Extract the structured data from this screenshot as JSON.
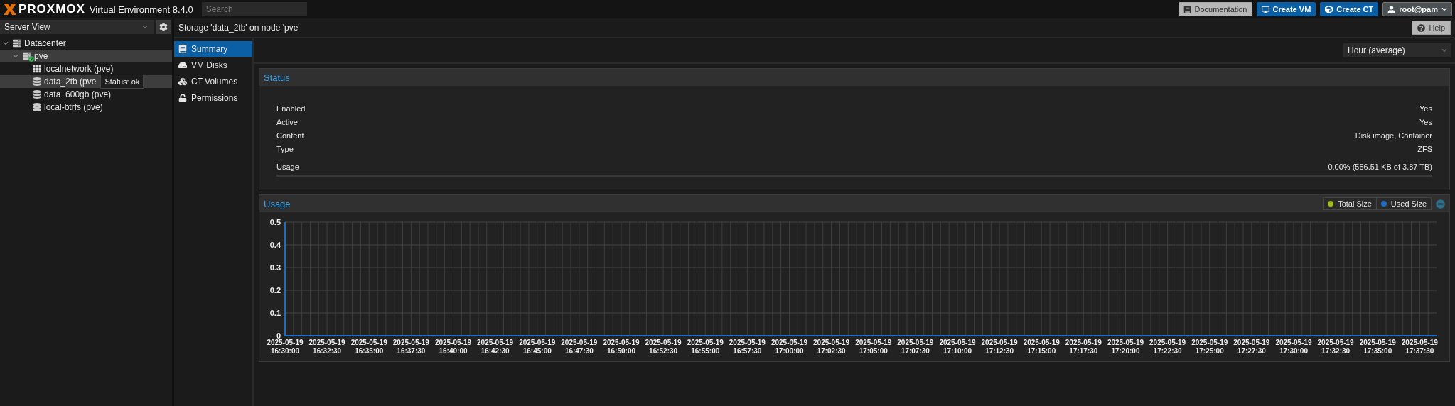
{
  "header": {
    "logo": "PROXMOX",
    "product": "Virtual Environment 8.4.0",
    "search": {
      "placeholder": "Search"
    },
    "buttons": [
      {
        "label": "Documentation",
        "kind": "doc"
      },
      {
        "label": "Create VM",
        "kind": "vm"
      },
      {
        "label": "Create CT",
        "kind": "ct"
      },
      {
        "label": "root@pam",
        "kind": "user"
      }
    ]
  },
  "sidebar": {
    "view": "Server View",
    "tree": [
      {
        "label": "Datacenter",
        "kind": "datacenter",
        "expanded": true,
        "selected": false,
        "children": [
          {
            "label": "pve",
            "kind": "node",
            "expanded": true,
            "selected": true,
            "children": [
              {
                "label": "localnetwork (pve)",
                "kind": "network",
                "selected": false
              },
              {
                "label": "data_2tb (pve",
                "kind": "storage",
                "selected": true,
                "tooltip": "Status: ok"
              },
              {
                "label": "data_600gb (pve)",
                "kind": "storage",
                "selected": false
              },
              {
                "label": "local-btrfs (pve)",
                "kind": "storage",
                "selected": false
              }
            ]
          }
        ]
      }
    ]
  },
  "page": {
    "title": "Storage 'data_2tb' on node 'pve'",
    "help": "Help"
  },
  "nav": [
    {
      "label": "Summary",
      "kind": "summary",
      "selected": true
    },
    {
      "label": "VM Disks",
      "kind": "disks",
      "selected": false
    },
    {
      "label": "CT Volumes",
      "kind": "volumes",
      "selected": false
    },
    {
      "label": "Permissions",
      "kind": "permissions",
      "selected": false
    }
  ],
  "timeframe": "Hour (average)",
  "status": {
    "title": "Status",
    "rows": [
      {
        "label": "Enabled",
        "value": "Yes"
      },
      {
        "label": "Active",
        "value": "Yes"
      },
      {
        "label": "Content",
        "value": "Disk image, Container"
      },
      {
        "label": "Type",
        "value": "ZFS"
      }
    ],
    "usage": {
      "label": "Usage",
      "value": "0.00% (556.51 KB of 3.87 TB)",
      "level": 0
    }
  },
  "usage_chart": {
    "title": "Usage",
    "chart_data": {
      "type": "line",
      "grid": true,
      "categories": [
        "2025-05-19\n16:30:00",
        "2025-05-19\n16:32:30",
        "2025-05-19\n16:35:00",
        "2025-05-19\n16:37:30",
        "2025-05-19\n16:40:00",
        "2025-05-19\n16:42:30",
        "2025-05-19\n16:45:00",
        "2025-05-19\n16:47:30",
        "2025-05-19\n16:50:00",
        "2025-05-19\n16:52:30",
        "2025-05-19\n16:55:00",
        "2025-05-19\n16:57:30",
        "2025-05-19\n17:00:00",
        "2025-05-19\n17:02:30",
        "2025-05-19\n17:05:00",
        "2025-05-19\n17:07:30",
        "2025-05-19\n17:10:00",
        "2025-05-19\n17:12:30",
        "2025-05-19\n17:15:00",
        "2025-05-19\n17:17:30",
        "2025-05-19\n17:20:00",
        "2025-05-19\n17:22:30",
        "2025-05-19\n17:25:00",
        "2025-05-19\n17:27:30",
        "2025-05-19\n17:30:00",
        "2025-05-19\n17:32:30",
        "2025-05-19\n17:35:00",
        "2025-05-19\n17:37:30"
      ],
      "ylim": [
        0,
        0.5
      ],
      "yticks": [
        0,
        0.1,
        0.2,
        0.3,
        0.4,
        0.5
      ],
      "series": [
        {
          "name": "Total Size",
          "color": "#9dbd15",
          "values": [
            null,
            null,
            null,
            null,
            null,
            null,
            null,
            null,
            null,
            null,
            null,
            null,
            null,
            null,
            null,
            null,
            null,
            null,
            null,
            null,
            null,
            null,
            null,
            null,
            null,
            null,
            null,
            null
          ]
        },
        {
          "name": "Used Size",
          "color": "#1b6ec2",
          "values": [
            null,
            null,
            null,
            null,
            null,
            null,
            null,
            null,
            null,
            null,
            null,
            null,
            null,
            null,
            null,
            null,
            null,
            null,
            null,
            null,
            null,
            null,
            null,
            null,
            null,
            null,
            null,
            null
          ]
        }
      ]
    }
  }
}
